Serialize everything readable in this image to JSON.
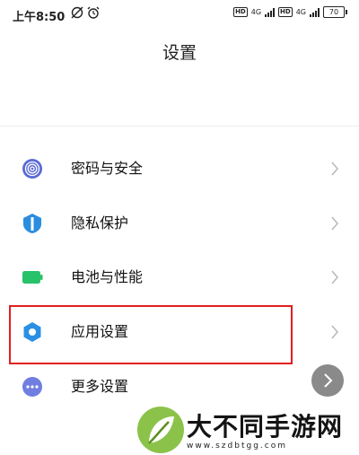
{
  "status_bar": {
    "time": "上午8:50",
    "network_left": "4G",
    "network_right": "4G",
    "battery": "70"
  },
  "header": {
    "title": "设置"
  },
  "settings": {
    "items": [
      {
        "label": "密码与安全",
        "icon": "fingerprint-icon",
        "color": "#5b6bd6"
      },
      {
        "label": "隐私保护",
        "icon": "shield-icon",
        "color": "#2a8de0"
      },
      {
        "label": "电池与性能",
        "icon": "battery-icon",
        "color": "#27c26a"
      },
      {
        "label": "应用设置",
        "icon": "gear-icon",
        "color": "#2b8fe4"
      },
      {
        "label": "更多设置",
        "icon": "more-icon",
        "color": "#6f7ee0"
      }
    ]
  },
  "annotation": {
    "highlight_color": "#e02020"
  },
  "watermark": {
    "name": "大不同手游网",
    "url": "www.szdbtgg.com"
  }
}
